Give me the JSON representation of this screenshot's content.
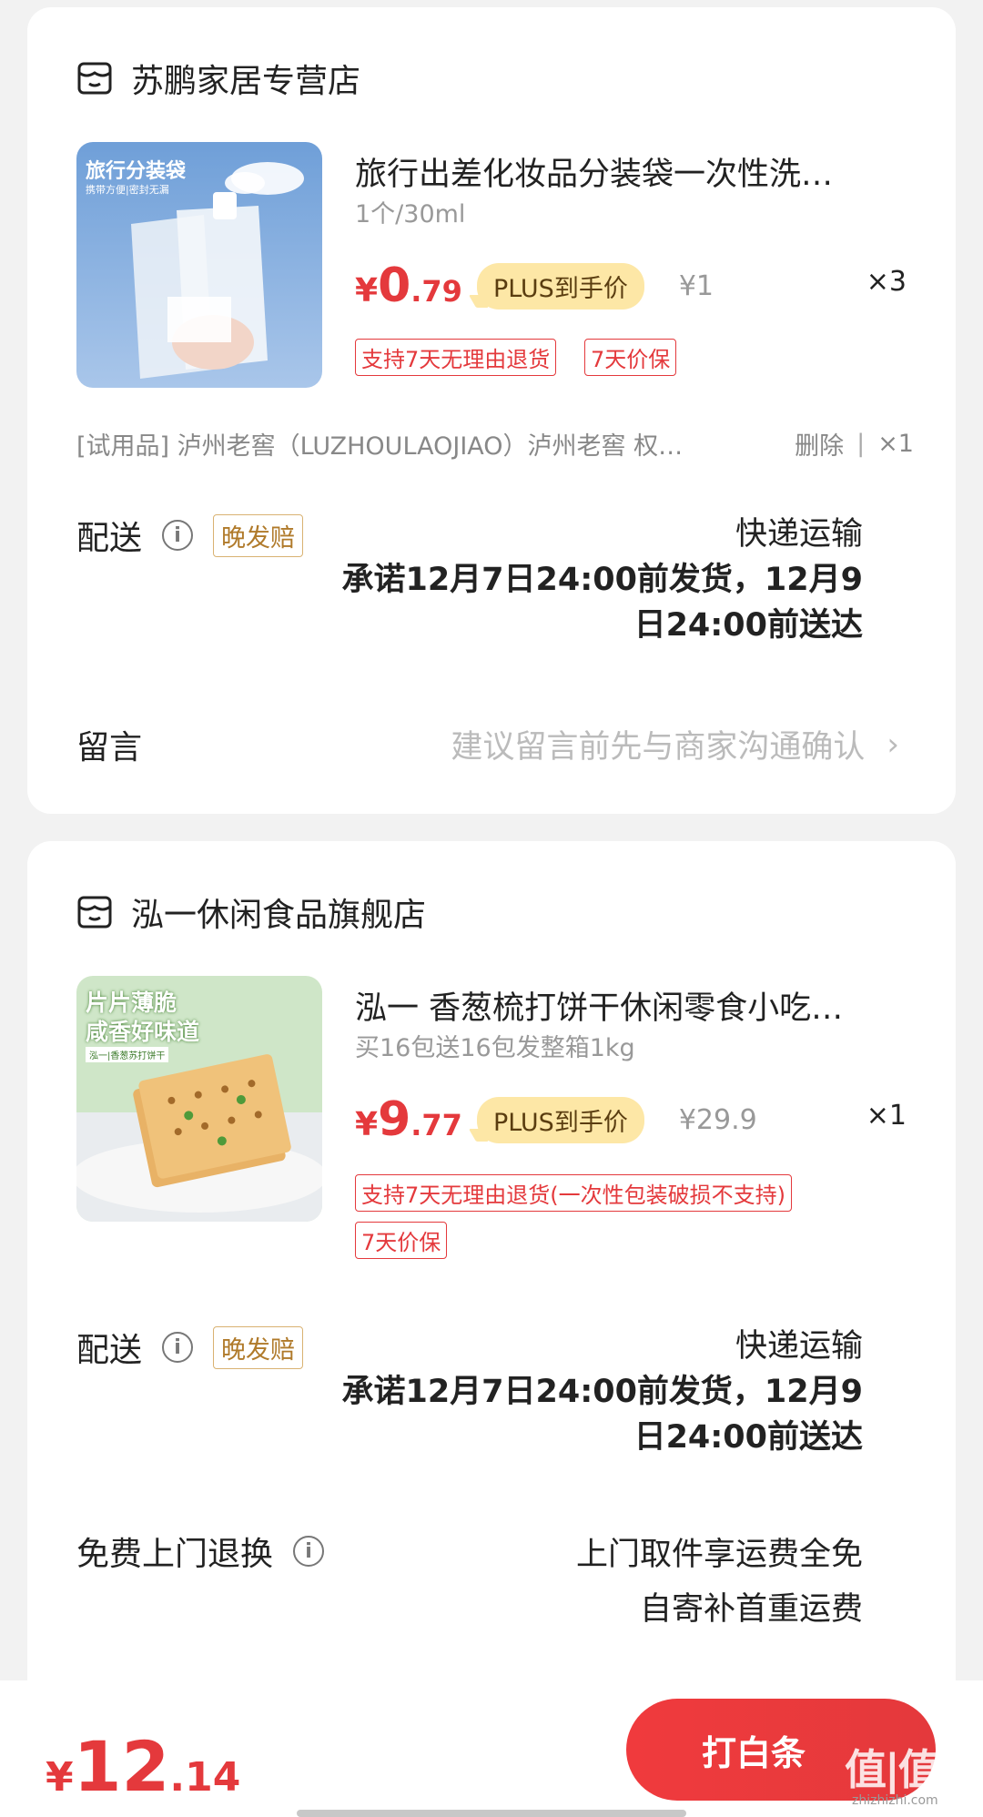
{
  "stores": [
    {
      "shop_name": "苏鹏家居专营店",
      "product": {
        "title": "旅行出差化妆品分装袋一次性洗…",
        "spec": "1个/30ml",
        "price_symbol": "¥",
        "price_int": "0",
        "price_dec": ".79",
        "plus_label": "PLUS到手价",
        "orig_price": "¥1",
        "qty": "×3",
        "tags": [
          "支持7天无理由退货",
          "7天价保"
        ],
        "image_text": {
          "line1": "旅行分装袋",
          "line2": "携带方便|密封无漏"
        }
      },
      "trial": {
        "text": "[试用品]  泸州老窖（LUZHOULAOJIAO）泸州老窖  权…",
        "delete_label": "删除",
        "sep": "|",
        "qty": "×1"
      },
      "delivery": {
        "label": "配送",
        "badge": "晚发赔",
        "method": "快递运输",
        "line1": "承诺12月7日24:00前发货，12月9",
        "line2": "日24:00前送达"
      },
      "remark": {
        "label": "留言",
        "placeholder": "建议留言前先与商家沟通确认"
      }
    },
    {
      "shop_name": "泓一休闲食品旗舰店",
      "product": {
        "title": "泓一 香葱梳打饼干休闲零食小吃…",
        "spec": "买16包送16包发整箱1kg",
        "price_symbol": "¥",
        "price_int": "9",
        "price_dec": ".77",
        "plus_label": "PLUS到手价",
        "orig_price": "¥29.9",
        "qty": "×1",
        "tags": [
          "支持7天无理由退货(一次性包装破损不支持)",
          "7天价保"
        ],
        "image_text": {
          "line1": "片片薄脆",
          "line2": "咸香好味道",
          "line3": "泓一|香葱苏打饼干"
        }
      },
      "delivery": {
        "label": "配送",
        "badge": "晚发赔",
        "method": "快递运输",
        "line1": "承诺12月7日24:00前发货，12月9",
        "line2": "日24:00前送达"
      },
      "return": {
        "label": "免费上门退换",
        "line1": "上门取件享运费全免",
        "line2": "自寄补首重运费"
      }
    }
  ],
  "footer": {
    "total_symbol": "¥",
    "total_int": "12",
    "total_dec": ".14",
    "pay_button": "打白条",
    "watermark": "值|值|值",
    "watermark_url": "zhizhizhi.com"
  },
  "colors": {
    "accent": "#e4393c",
    "plus_bg": "#fde7a6",
    "background": "#f2f2f2"
  }
}
